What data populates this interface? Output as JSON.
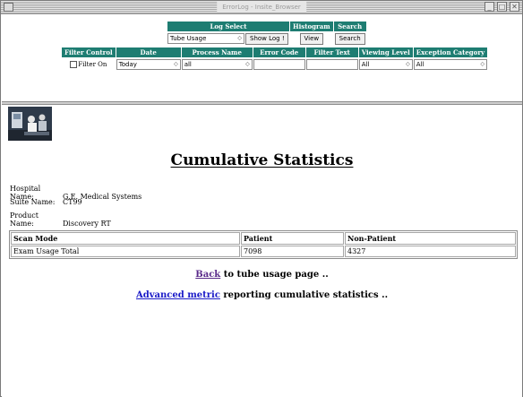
{
  "window": {
    "title": "ErrorLog - Insite_Browser",
    "buttons": [
      "_",
      "□",
      "✕"
    ]
  },
  "controls": {
    "log_select_header": "Log Select",
    "histogram_header": "Histogram",
    "search_header": "Search",
    "log_select_value": "Tube Usage",
    "show_log_button": "Show Log !",
    "view_button": "View",
    "search_button": "Search",
    "filters": {
      "filter_control_header": "Filter Control",
      "date_header": "Date",
      "process_name_header": "Process Name",
      "error_code_header": "Error Code",
      "filter_text_header": "Filter Text",
      "viewing_level_header": "Viewing Level",
      "exception_category_header": "Exception Category",
      "filter_on_label": "Filter On",
      "date_value": "Today",
      "process_name_value": "all",
      "error_code_value": "",
      "filter_text_value": "",
      "viewing_level_value": "All",
      "exception_category_value": "All"
    }
  },
  "content": {
    "title": "Cumulative Statistics",
    "info": [
      {
        "key": "Hospital Name:",
        "value": "G.E. Medical Systems"
      },
      {
        "key": "Suite Name:",
        "value": "CT99"
      },
      {
        "key": "Product Name:",
        "value": "Discovery RT"
      }
    ],
    "table": {
      "headers": [
        "Scan Mode",
        "Patient",
        "Non-Patient"
      ],
      "rows": [
        [
          "Exam Usage Total",
          "7098",
          "4327"
        ]
      ]
    },
    "back_link": "Back",
    "back_rest": " to tube usage page ..",
    "advanced_link": "Advanced metric",
    "advanced_rest": " reporting cumulative statistics .."
  },
  "colors": {
    "header_bg": "#1e7d72",
    "visited_link": "#5a2a8a",
    "link": "#1a1ac8"
  }
}
